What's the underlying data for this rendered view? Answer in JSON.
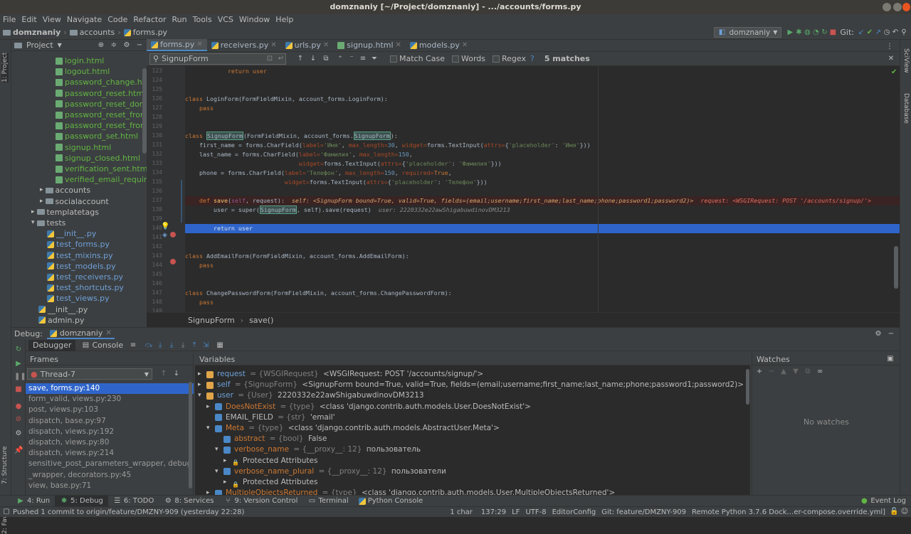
{
  "window": {
    "title": "domznaniy [~/Project/domznaniy] - .../accounts/forms.py"
  },
  "menu": [
    "File",
    "Edit",
    "View",
    "Navigate",
    "Code",
    "Refactor",
    "Run",
    "Tools",
    "VCS",
    "Window",
    "Help"
  ],
  "breadcrumb": [
    "domznaniy",
    "accounts",
    "forms.py"
  ],
  "run_config": "domznaniy",
  "git_label": "Git:",
  "project": {
    "title": "Project",
    "items": [
      {
        "label": "login.html",
        "type": "html",
        "indent": 62
      },
      {
        "label": "logout.html",
        "type": "html",
        "indent": 62
      },
      {
        "label": "password_change.html",
        "type": "html",
        "indent": 62
      },
      {
        "label": "password_reset.html",
        "type": "html",
        "indent": 62
      },
      {
        "label": "password_reset_done.h",
        "type": "html",
        "indent": 62
      },
      {
        "label": "password_reset_from_k",
        "type": "html",
        "indent": 62
      },
      {
        "label": "password_reset_from_k",
        "type": "html",
        "indent": 62
      },
      {
        "label": "password_set.html",
        "type": "html",
        "indent": 62
      },
      {
        "label": "signup.html",
        "type": "html",
        "indent": 62
      },
      {
        "label": "signup_closed.html",
        "type": "html",
        "indent": 62
      },
      {
        "label": "verification_sent.html",
        "type": "html",
        "indent": 62
      },
      {
        "label": "verified_email_required",
        "type": "html",
        "indent": 62
      },
      {
        "label": "accounts",
        "type": "folder",
        "indent": 40
      },
      {
        "label": "socialaccount",
        "type": "folder",
        "indent": 40
      },
      {
        "label": "templatetags",
        "type": "folder",
        "indent": 28
      },
      {
        "label": "tests",
        "type": "folder-open",
        "indent": 28
      },
      {
        "label": "__init__.py",
        "type": "py",
        "indent": 50
      },
      {
        "label": "test_forms.py",
        "type": "py",
        "indent": 50
      },
      {
        "label": "test_mixins.py",
        "type": "py",
        "indent": 50
      },
      {
        "label": "test_models.py",
        "type": "py",
        "indent": 50
      },
      {
        "label": "test_receivers.py",
        "type": "py",
        "indent": 50
      },
      {
        "label": "test_shortcuts.py",
        "type": "py",
        "indent": 50
      },
      {
        "label": "test_views.py",
        "type": "py",
        "indent": 50
      },
      {
        "label": "__init__.py",
        "type": "py",
        "indent": 38
      },
      {
        "label": "admin.py",
        "type": "py",
        "indent": 38
      }
    ]
  },
  "tabs": [
    {
      "label": "forms.py",
      "type": "py",
      "active": true
    },
    {
      "label": "receivers.py",
      "type": "py",
      "active": false
    },
    {
      "label": "urls.py",
      "type": "py",
      "active": false
    },
    {
      "label": "signup.html",
      "type": "html",
      "active": false
    },
    {
      "label": "models.py",
      "type": "py",
      "active": false
    }
  ],
  "find": {
    "query": "SignupForm",
    "match_case": "Match Case",
    "words": "Words",
    "regex": "Regex",
    "help": "?",
    "matches": "5 matches"
  },
  "gutter_lines": [
    "123",
    "124",
    "125",
    "126",
    "127",
    "128",
    "129",
    "130",
    "131",
    "132",
    "133",
    "134",
    "135",
    "136",
    "137",
    "138",
    "139",
    "140",
    "141",
    "142",
    "143",
    "144",
    "145",
    "146",
    "147",
    "148",
    "149",
    "150"
  ],
  "code": {
    "l123": "            return user",
    "l126_kw": "class ",
    "l126_rest": "LoginForm(FormFieldMixin, account_forms.LoginForm):",
    "l127": "    pass",
    "l130_a": "class ",
    "l130_b": "SignupForm",
    "l130_c": "(FormFieldMixin, account_forms.",
    "l130_d": "SignupForm",
    "l130_e": "):",
    "l131_a": "    first_name = forms.CharField(",
    "l131_b": "label=",
    "l131_c": "'Имя'",
    "l131_d": ", ",
    "l131_e": "max_length=",
    "l131_f": "30",
    "l131_g": ", ",
    "l131_h": "widget=",
    "l131_i": "forms.TextInput(",
    "l131_j": "attrs=",
    "l131_k": "{",
    "l131_l": "'placeholder'",
    "l131_m": ": ",
    "l131_n": "'Имя'",
    "l131_o": "}))",
    "l132_a": "    last_name = forms.CharField(",
    "l132_b": "label=",
    "l132_c": "'Фамилия'",
    "l132_d": ", ",
    "l132_e": "max_length=",
    "l132_f": "150",
    "l132_g": ",",
    "l133_a": "                                widget=",
    "l133_b": "forms.TextInput(",
    "l133_c": "attrs=",
    "l133_d": "{",
    "l133_e": "'placeholder'",
    "l133_f": ": ",
    "l133_g": "'Фамилия'",
    "l133_h": "}))",
    "l134_a": "    phone = forms.CharField(",
    "l134_b": "label=",
    "l134_c": "'Телефон'",
    "l134_d": ", ",
    "l134_e": "max_length=",
    "l134_f": "150",
    "l134_g": ", ",
    "l134_h": "required=",
    "l134_i": "True",
    "l134_j": ",",
    "l135_a": "                            widget=",
    "l135_b": "forms.TextInput(",
    "l135_c": "attrs=",
    "l135_d": "{",
    "l135_e": "'placeholder'",
    "l135_f": ": ",
    "l135_g": "'Телефон'",
    "l135_h": "}))",
    "l137_a": "    def ",
    "l137_b": "save",
    "l137_c": "(",
    "l137_d": "self",
    "l137_e": ", request):",
    "l137_hint1": "  self: <SignupForm bound=True, valid=True, fields=(email;username;first_name;last_name;phone;password1;password2)>",
    "l137_hint2": "  request: <WSGIRequest: POST '/accounts/signup/'>",
    "l138_a": "        user = super(",
    "l138_b": "SignupForm",
    "l138_c": ", self).save(request)",
    "l138_hint": "  user: 2220332e22awShigabuwdinovDM3213",
    "l140": "        return user",
    "l143_a": "class ",
    "l143_b": "AddEmailForm(FormFieldMixin, account_forms.AddEmailForm):",
    "l144": "    pass",
    "l147_a": "class ",
    "l147_b": "ChangePasswordForm(FormFieldMixin, account_forms.ChangePasswordForm):",
    "l148": "    pass"
  },
  "editor_crumb": [
    "SignupForm",
    "save()"
  ],
  "debug": {
    "label": "Debug:",
    "config": "domznaniy",
    "tab_debugger": "Debugger",
    "tab_console": "Console",
    "frames_title": "Frames",
    "thread": "Thread-7",
    "variables_title": "Variables",
    "watches_title": "Watches",
    "no_watches": "No watches",
    "frames": [
      "save, forms.py:140",
      "form_valid, views.py:230",
      "post, views.py:103",
      "dispatch, base.py:97",
      "dispatch, views.py:192",
      "dispatch, views.py:80",
      "dispatch, views.py:214",
      "sensitive_post_parameters_wrapper, debug",
      "_wrapper, decorators.py:45",
      "view, base.py:71"
    ],
    "vars": [
      {
        "name": "request",
        "type": " = {WSGIRequest} ",
        "val": "<WSGIRequest: POST '/accounts/signup/'>",
        "indent": 0,
        "arrow": "▸",
        "cls": "vname2"
      },
      {
        "name": "self",
        "type": " = {SignupForm} ",
        "val": "<SignupForm bound=True, valid=True, fields=(email;username;first_name;last_name;phone;password1;password2)>",
        "indent": 0,
        "arrow": "▸",
        "cls": "vname2"
      },
      {
        "name": "user",
        "type": " = {User} ",
        "val": "2220332e22awShigabuwdinovDM3213",
        "indent": 0,
        "arrow": "▾",
        "cls": "vname2"
      },
      {
        "name": "DoesNotExist",
        "type": " = {type} ",
        "val": "<class 'django.contrib.auth.models.User.DoesNotExist'>",
        "indent": 12,
        "arrow": "▸",
        "cls": "vname"
      },
      {
        "name": "EMAIL_FIELD",
        "type": " = {str} ",
        "val": "'email'",
        "indent": 12,
        "arrow": "",
        "cls": "vval"
      },
      {
        "name": "Meta",
        "type": " = {type} ",
        "val": "<class 'django.contrib.auth.models.AbstractUser.Meta'>",
        "indent": 12,
        "arrow": "▾",
        "cls": "vname"
      },
      {
        "name": "abstract",
        "type": " = {bool} ",
        "val": "False",
        "indent": 24,
        "arrow": "",
        "cls": "vname"
      },
      {
        "name": "verbose_name",
        "type": " = {__proxy__: 12} ",
        "val": "пользователь",
        "indent": 24,
        "arrow": "▾",
        "cls": "vname"
      },
      {
        "name": "Protected Attributes",
        "type": "",
        "val": "",
        "indent": 36,
        "arrow": "▸",
        "cls": "vval"
      },
      {
        "name": "verbose_name_plural",
        "type": " = {__proxy__: 12} ",
        "val": "пользователи",
        "indent": 24,
        "arrow": "▾",
        "cls": "vname"
      },
      {
        "name": "Protected Attributes",
        "type": "",
        "val": "",
        "indent": 36,
        "arrow": "▸",
        "cls": "vval"
      },
      {
        "name": "MultipleObjectsReturned",
        "type": " = {type} ",
        "val": "<class 'django.contrib.auth.models.User.MultipleObjectsReturned'>",
        "indent": 12,
        "arrow": "▸",
        "cls": "vname"
      }
    ]
  },
  "bottom_tabs": [
    {
      "label": "4: Run",
      "active": false
    },
    {
      "label": "5: Debug",
      "active": true
    },
    {
      "label": "6: TODO",
      "active": false
    },
    {
      "label": "8: Services",
      "active": false
    },
    {
      "label": "9: Version Control",
      "active": false
    },
    {
      "label": "Terminal",
      "active": false
    },
    {
      "label": "Python Console",
      "active": false
    }
  ],
  "event_log": "Event Log",
  "status": {
    "message": "Pushed 1 commit to origin/feature/DMZNY-909 (yesterday 22:28)",
    "chars": "1 char",
    "pos": "137:29",
    "lf": "LF",
    "enc": "UTF-8",
    "editorconfig": "EditorConfig",
    "git": "Git: feature/DMZNY-909",
    "interpreter": "Remote Python 3.7.6 Dock…er-compose.override.yml]"
  },
  "left_strip": [
    "1: Project",
    "7: Structure",
    "2: Favorites"
  ],
  "right_strip": [
    "SciView",
    "Database"
  ],
  "colors": {
    "accent": "#4a88c7",
    "selection": "#2f65ca",
    "breakpoint": "#c75450",
    "green": "#62b543"
  }
}
